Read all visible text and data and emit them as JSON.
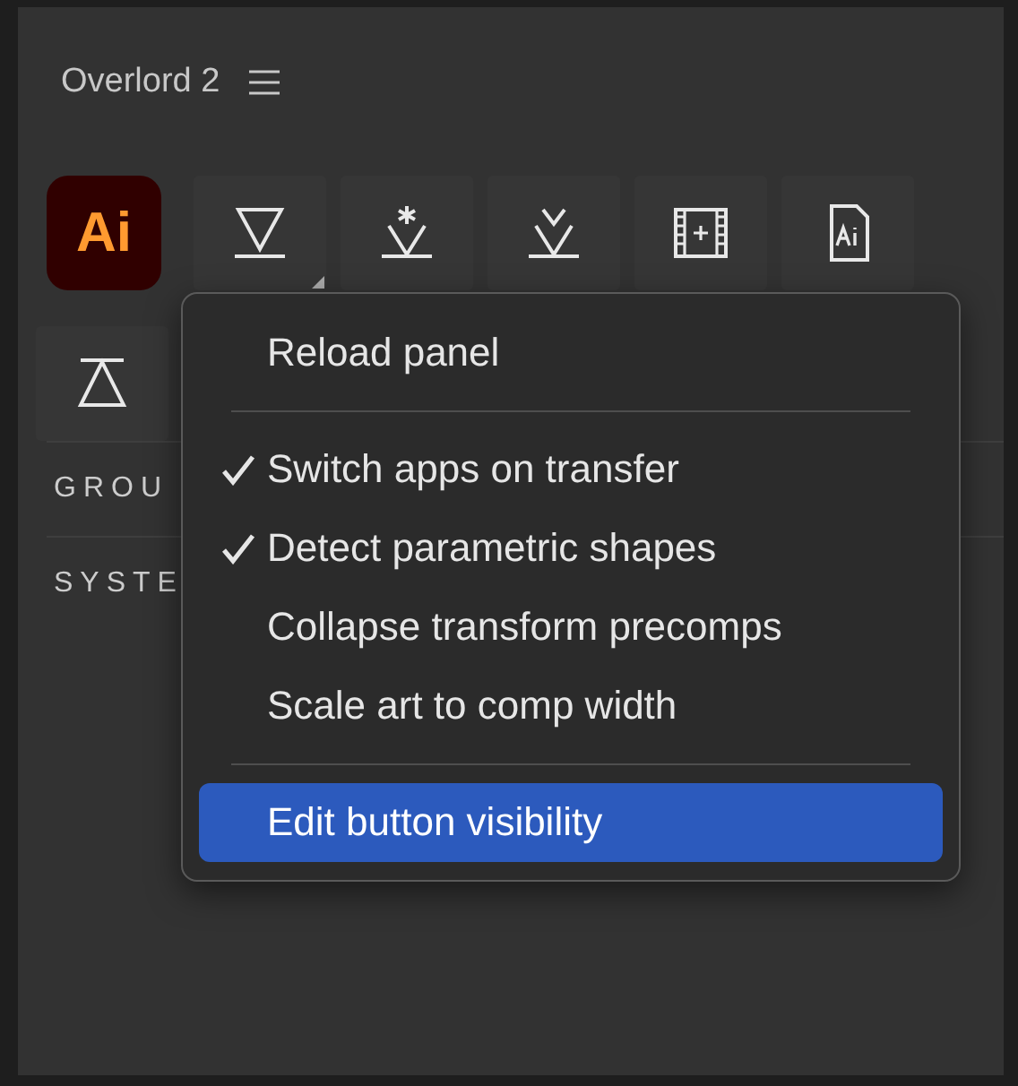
{
  "panel": {
    "title": "Overlord 2",
    "tool_rows": [
      [
        {
          "kind": "logo",
          "label": "Ai",
          "has_menu": false
        },
        {
          "kind": "tool",
          "has_menu": true
        },
        {
          "kind": "tool",
          "has_menu": false
        },
        {
          "kind": "tool",
          "has_menu": false
        },
        {
          "kind": "tool",
          "has_menu": false
        },
        {
          "kind": "tool",
          "has_menu": false
        }
      ],
      [
        {
          "kind": "tool",
          "has_menu": false
        }
      ]
    ],
    "sections": [
      {
        "label": "GROU"
      },
      {
        "label": "SYSTE"
      }
    ]
  },
  "menu": {
    "items": [
      {
        "kind": "item",
        "label": "Reload panel",
        "checked": false,
        "selected": false
      },
      {
        "kind": "separator"
      },
      {
        "kind": "item",
        "label": "Switch apps on transfer",
        "checked": true,
        "selected": false
      },
      {
        "kind": "item",
        "label": "Detect parametric shapes",
        "checked": true,
        "selected": false
      },
      {
        "kind": "item",
        "label": "Collapse transform precomps",
        "checked": false,
        "selected": false
      },
      {
        "kind": "item",
        "label": "Scale art to comp width",
        "checked": false,
        "selected": false
      },
      {
        "kind": "separator"
      },
      {
        "kind": "item",
        "label": "Edit button visibility",
        "checked": false,
        "selected": true
      }
    ]
  }
}
